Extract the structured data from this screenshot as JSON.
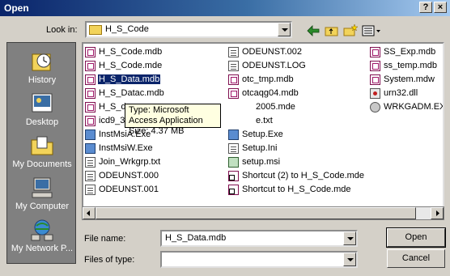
{
  "window": {
    "title": "Open",
    "help_button": "?",
    "close_button": "×"
  },
  "lookin": {
    "label": "Look in:",
    "value": "H_S_Code"
  },
  "places": [
    {
      "label": "History"
    },
    {
      "label": "Desktop"
    },
    {
      "label": "My Documents"
    },
    {
      "label": "My Computer"
    },
    {
      "label": "My Network P..."
    }
  ],
  "files": {
    "col1": [
      "H_S_Code.mdb",
      "H_S_Code.mde",
      "H_S_Data.mdb",
      "H_S_Datac.mdb",
      "H_S_d",
      "icd9_3",
      "InstMsiA.Exe",
      "InstMsiW.Exe",
      "Join_Wrkgrp.txt",
      "ODEUNST.000",
      "ODEUNST.001"
    ],
    "col2": [
      "ODEUNST.002",
      "ODEUNST.LOG",
      "otc_tmp.mdb",
      "otcaqg04.mdb",
      "2005.mde",
      "e.txt",
      "Setup.Exe",
      "Setup.Ini",
      "setup.msi",
      "Shortcut (2) to H_S_Code.mde",
      "Shortcut to H_S_Code.mde"
    ],
    "col3": [
      "SS_Exp.mdb",
      "ss_temp.mdb",
      "System.mdw",
      "urn32.dll",
      "WRKGADM.EXE"
    ]
  },
  "tooltip": {
    "line1": "Type: Microsoft Access Application",
    "line2": "Size: 4.37 MB"
  },
  "filename": {
    "label": "File name:",
    "value": "H_S_Data.mdb"
  },
  "filetype": {
    "label": "Files of type:",
    "value": ""
  },
  "buttons": {
    "open": "Open",
    "cancel": "Cancel"
  }
}
